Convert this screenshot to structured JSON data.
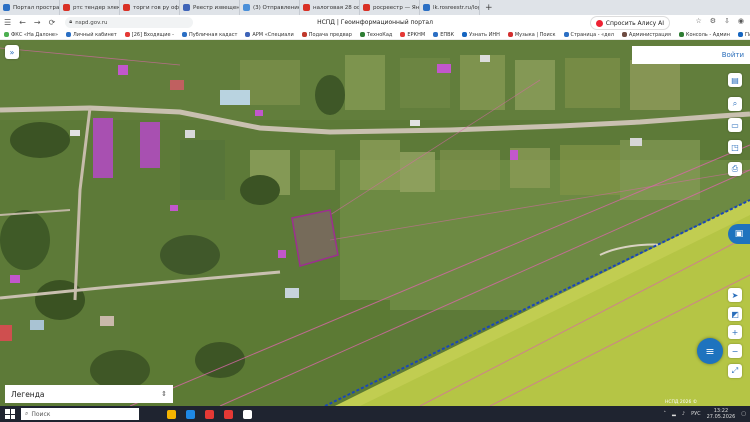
{
  "browser": {
    "tabs": [
      {
        "title": "Портал пространствен",
        "color": "#2b6fc4",
        "active": false
      },
      {
        "title": "ртс тендер электронн",
        "color": "#d93025",
        "active": false
      },
      {
        "title": "торги гов ру официа",
        "color": "#d93025",
        "active": false
      },
      {
        "title": "Реестр извещений",
        "color": "#3e64b8",
        "active": false
      },
      {
        "title": "(3) Отправление - По",
        "color": "#4a8fd9",
        "active": false
      },
      {
        "title": "налоговая 28 официа",
        "color": "#d93025",
        "active": false
      },
      {
        "title": "росреестр — Яндекс",
        "color": "#d93025",
        "active": false
      },
      {
        "title": "lk.rosreestr.ru/login?redi",
        "color": "#2b6fc4",
        "active": false
      }
    ],
    "new_tab": "+",
    "url": "nspd.gov.ru",
    "page_title": "НСПД | Геоинформационный портал",
    "alice": "Спросить Алису AI",
    "bookmarks": [
      {
        "label": "ФКС «На Далоне»",
        "color": "#4caf50"
      },
      {
        "label": "Личный кабинет",
        "color": "#2b6fc4"
      },
      {
        "label": "[26] Входящие -",
        "color": "#e53935"
      },
      {
        "label": "Публичная кадаст",
        "color": "#2b6fc4"
      },
      {
        "label": "АРМ «Специали",
        "color": "#3e64b8"
      },
      {
        "label": "Подача предвар",
        "color": "#c0392b"
      },
      {
        "label": "ТехноКад",
        "color": "#2e7d32"
      },
      {
        "label": "ЕРКНМ",
        "color": "#e53935"
      },
      {
        "label": "ЕПВК",
        "color": "#2b6fc4"
      },
      {
        "label": "Узнать ИНН",
        "color": "#1565c0"
      },
      {
        "label": "Музыка | Поиск",
        "color": "#d32f2f"
      },
      {
        "label": "Страница - «дел",
        "color": "#2b6fc4"
      },
      {
        "label": "Администрация",
        "color": "#6d4c41"
      },
      {
        "label": "Консоль - Админ",
        "color": "#2e7d32"
      },
      {
        "label": "ГИС Торги",
        "color": "#1565c0"
      }
    ]
  },
  "map": {
    "login": "Войти",
    "legend": "Легенда",
    "scale_text": "НСПД 2026 ©"
  },
  "taskbar": {
    "search_placeholder": "Поиск",
    "lang": "РУС",
    "time": "13:22",
    "date": "27.05.2026",
    "app_colors": [
      "#f5b400",
      "#1e88e5",
      "#e53935",
      "#e53935",
      "#ffffff"
    ]
  }
}
